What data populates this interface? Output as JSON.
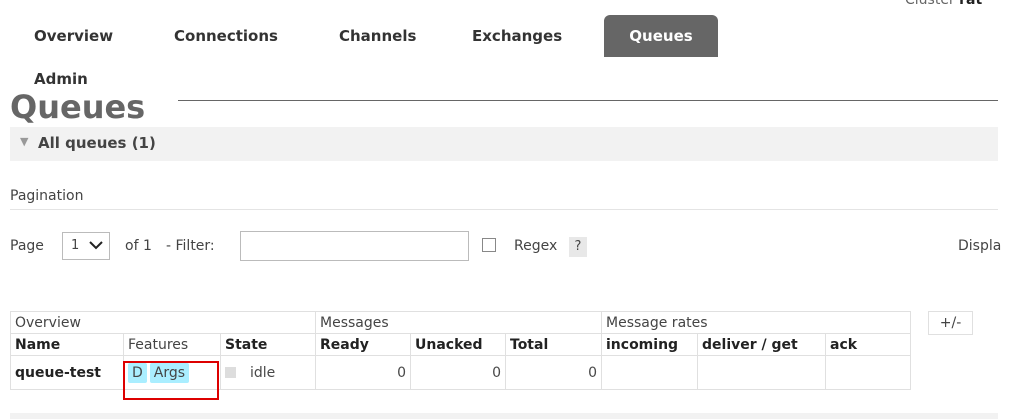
{
  "header": {
    "cluster_label": "Cluster",
    "cluster_name": "rat"
  },
  "nav": {
    "tabs": [
      {
        "label": "Overview"
      },
      {
        "label": "Connections"
      },
      {
        "label": "Channels"
      },
      {
        "label": "Exchanges"
      },
      {
        "label": "Queues",
        "active": true
      },
      {
        "label": "Admin"
      }
    ]
  },
  "page": {
    "title": "Queues"
  },
  "section": {
    "label": "All queues (1)"
  },
  "pagination": {
    "label": "Pagination",
    "page_label": "Page",
    "page_value": "1",
    "of_label": "of 1",
    "filter_label": "- Filter:",
    "filter_value": "",
    "regex_label": "Regex",
    "help_label": "?",
    "display_label": "Displa"
  },
  "table": {
    "groups": [
      "Overview",
      "Messages",
      "Message rates"
    ],
    "toggle_label": "+/-",
    "columns": [
      "Name",
      "Features",
      "State",
      "Ready",
      "Unacked",
      "Total",
      "incoming",
      "deliver / get",
      "ack"
    ],
    "rows": [
      {
        "name": "queue-test",
        "features": [
          "D",
          "Args"
        ],
        "state": "idle",
        "ready": "0",
        "unacked": "0",
        "total": "0",
        "incoming": "",
        "deliver_get": "",
        "ack": ""
      }
    ]
  },
  "colors": {
    "active_tab_bg": "#666666",
    "feature_badge_bg": "#aaeeff",
    "highlight_border": "#dd0000"
  }
}
